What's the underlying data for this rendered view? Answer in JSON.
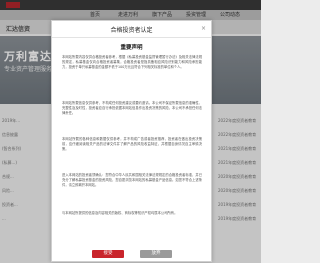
{
  "site": {
    "header_title": "汇达信资",
    "nav": [
      "首页",
      "走进万利",
      "旗下产品",
      "投资管理",
      "公司动态"
    ],
    "banner_line1": "万利富达",
    "banner_line2": "专业资产管理服务",
    "left_rows": [
      "2019年...",
      "信息披露",
      "(智合系列)",
      "(私募...)",
      "合规...",
      "风险...",
      "投资者...",
      "..."
    ],
    "right_rows": [
      "2022年度投资者教育",
      "2022年度投资者教育",
      "2021年度投资者教育",
      "2021年度投资者教育",
      "2020年度投资者教育",
      "2020年度投资者教育",
      "2019年度投资者教育",
      "2019年度投资者教育"
    ]
  },
  "modal": {
    "title": "合格投资者认定",
    "close_glyph": "×",
    "doc_title": "重要声明",
    "paragraphs": [
      "本网站所载内容仅供合格投资者参考，根据《私募投资基金监督管理暂行办法》及相关法律法规的规定，私募基金仅向合格投资者募集，合格投资者是指具备相应风险识别能力和风险承担能力，投资于单只私募基金的金额不低于100万元且符合下列相关标准的单位和个人。",
      "本网站所载信息仅供参考，不构成任何投资建议或要约邀请。本公司不保证所载信息的准确性、完整性及及时性，投资者应自行承担依据本网站信息作出投资决策的风险，本公司不承担任何法律责任。",
      "本网站所载的各种信息和数据仅供参考，并不构成广告或者投资推荐，投资者在做出投资决策前，应仔细阅读相关产品的法律文件并了解产品的风险收益特征，并根据自身情况自主审慎决策。",
      "进入本网站的投资者须确认：您符合中华人民共和国相关法律法规规定的合格投资者标准，并已充分了解私募投资基金的投资风险，您自愿浏览本网站的私募基金产品信息。如您不符合上述条件，请立即离开本网站。",
      "与本网站所提供的信息及内容相关的版权、商标权等知识产权均属本公司所有。"
    ],
    "agree_label": "接受",
    "decline_label": "放弃"
  }
}
